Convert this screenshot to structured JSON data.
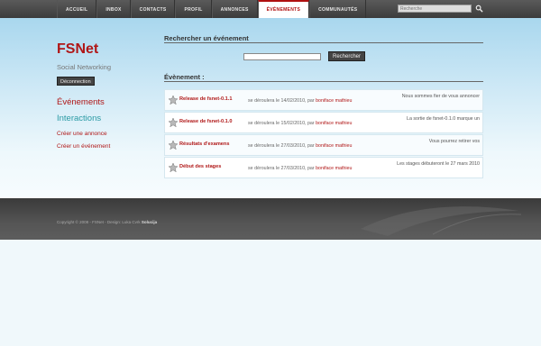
{
  "nav": {
    "items": [
      {
        "label": "ACCUEIL"
      },
      {
        "label": "INBOX"
      },
      {
        "label": "CONTACTS"
      },
      {
        "label": "PROFIL"
      },
      {
        "label": "ANNONCES"
      },
      {
        "label": "ÉVÉNEMENTS"
      },
      {
        "label": "COMMUNAUTÉS"
      }
    ],
    "active": "ÉVÉNEMENTS",
    "search_placeholder": "Recherche",
    "search_icon": "search-icon"
  },
  "sidebar": {
    "brand": "FSNet",
    "tagline": "Social Networking",
    "logout_label": "Déconnection",
    "heading_events": "Événements",
    "heading_interactions": "Interactions",
    "links": [
      "Créer une annonce",
      "Créer un événement"
    ]
  },
  "search_section": {
    "title": "Rechercher un événement",
    "input_value": "",
    "button_label": "Rechercher"
  },
  "events_section": {
    "title": "Évènement :",
    "items": [
      {
        "title": "Release de fsnet-0.1.1",
        "date_text": "se déroulera le 14/02/2010, par ",
        "author": "boniface mathieu",
        "description": "Nous sommes fier de vous annoncer"
      },
      {
        "title": "Release de fsnet-0.1.0",
        "date_text": "se déroulera le 15/02/2010, par ",
        "author": "boniface mathieu",
        "description": "La sortie de fsnet-0.1.0 marque un"
      },
      {
        "title": "Résultats d'examens",
        "date_text": "se déroulera le 27/03/2010, par ",
        "author": "boniface mathieu",
        "description": "Vous pourrez retirer vos"
      },
      {
        "title": "Début des stages",
        "date_text": "se déroulera le 27/03/2010, par ",
        "author": "boniface mathieu",
        "description": "Les stages débuteront le 27 mars 2010"
      }
    ]
  },
  "footer": {
    "copyright": "Copyright © 2008 - FSNet - Design: Luka Cvrk",
    "brand": "Solucija"
  },
  "colors": {
    "accent": "#b01717",
    "teal": "#2a9aa4",
    "topbar": "#3c3c3c"
  }
}
